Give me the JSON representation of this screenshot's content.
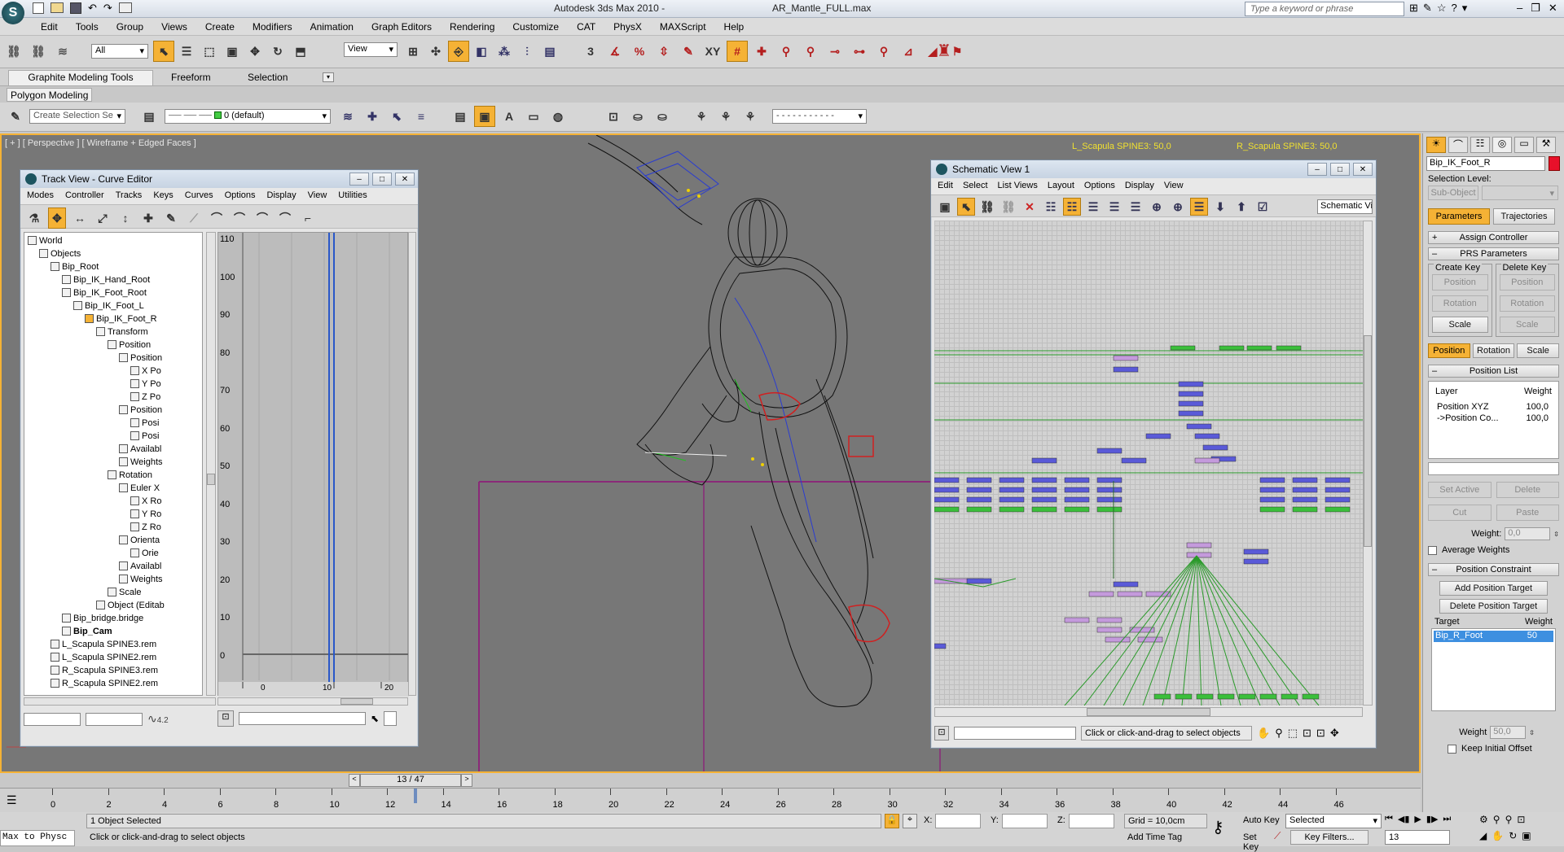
{
  "app": {
    "title": "Autodesk 3ds Max 2010",
    "file": "AR_Mantle_FULL.max",
    "search_placeholder": "Type a keyword or phrase"
  },
  "menu": [
    "Edit",
    "Tools",
    "Group",
    "Views",
    "Create",
    "Modifiers",
    "Animation",
    "Graph Editors",
    "Rendering",
    "Customize",
    "CAT",
    "PhysX",
    "MAXScript",
    "Help"
  ],
  "main_toolbar": {
    "filter": "All",
    "ref_coord": "View",
    "snap_label": "3"
  },
  "ribbon": {
    "tabs": [
      "Graphite Modeling Tools",
      "Freeform",
      "Selection"
    ],
    "sub_tab": "Polygon Modeling",
    "selection_set_placeholder": "Create Selection Se",
    "layer": "0 (default)"
  },
  "viewport": {
    "label": "[ + ] [ Perspective ] [ Wireframe + Edged Faces ]",
    "status_left": "L_Scapula SPINE3: 50,0",
    "status_right": "R_Scapula SPINE3: 50,0"
  },
  "curve_editor": {
    "title": "Track View - Curve Editor",
    "menu": [
      "Modes",
      "Controller",
      "Tracks",
      "Keys",
      "Curves",
      "Options",
      "Display",
      "View",
      "Utilities"
    ],
    "tree": [
      {
        "label": "World",
        "depth": 0
      },
      {
        "label": "Objects",
        "depth": 1
      },
      {
        "label": "Bip_Root",
        "depth": 2
      },
      {
        "label": "Bip_IK_Hand_Root",
        "depth": 3
      },
      {
        "label": "Bip_IK_Foot_Root",
        "depth": 3
      },
      {
        "label": "Bip_IK_Foot_L",
        "depth": 4
      },
      {
        "label": "Bip_IK_Foot_R",
        "depth": 5
      },
      {
        "label": "Transform",
        "depth": 6
      },
      {
        "label": "Position",
        "depth": 7
      },
      {
        "label": "Position",
        "depth": 8
      },
      {
        "label": "X Po",
        "depth": 9
      },
      {
        "label": "Y Po",
        "depth": 9
      },
      {
        "label": "Z Po",
        "depth": 9
      },
      {
        "label": "Position",
        "depth": 8
      },
      {
        "label": "Posi",
        "depth": 9
      },
      {
        "label": "Posi",
        "depth": 9
      },
      {
        "label": "Availabl",
        "depth": 8
      },
      {
        "label": "Weights",
        "depth": 8
      },
      {
        "label": "Rotation",
        "depth": 7
      },
      {
        "label": "Euler X",
        "depth": 8
      },
      {
        "label": "X Ro",
        "depth": 9
      },
      {
        "label": "Y Ro",
        "depth": 9
      },
      {
        "label": "Z Ro",
        "depth": 9
      },
      {
        "label": "Orienta",
        "depth": 8
      },
      {
        "label": "Orie",
        "depth": 9
      },
      {
        "label": "Availabl",
        "depth": 8
      },
      {
        "label": "Weights",
        "depth": 8
      },
      {
        "label": "Scale",
        "depth": 7
      },
      {
        "label": "Object (Editab",
        "depth": 6
      },
      {
        "label": "Bip_bridge.bridge",
        "depth": 3
      },
      {
        "label": "Bip_Cam",
        "depth": 3
      },
      {
        "label": "L_Scapula SPINE3.rem",
        "depth": 2
      },
      {
        "label": "L_Scapula SPINE2.rem",
        "depth": 2
      },
      {
        "label": "R_Scapula SPINE3.rem",
        "depth": 2
      },
      {
        "label": "R_Scapula SPINE2.rem",
        "depth": 2
      }
    ],
    "y_ticks": [
      "110",
      "100",
      "90",
      "80",
      "70",
      "60",
      "50",
      "40",
      "30",
      "20",
      "10",
      "0"
    ],
    "x_ticks": [
      "0",
      "10",
      "20"
    ],
    "bottom_value": "4.2"
  },
  "schematic": {
    "title": "Schematic View 1",
    "menu": [
      "Edit",
      "Select",
      "List Views",
      "Layout",
      "Options",
      "Display",
      "View"
    ],
    "view_name": "Schematic Vie",
    "status": "Click or click-and-drag to select objects"
  },
  "command_panel": {
    "object_name": "Bip_IK_Foot_R",
    "selection_level_label": "Selection Level:",
    "sub_object": "Sub-Object",
    "tabs": [
      "Parameters",
      "Trajectories"
    ],
    "assign_controller": "Assign Controller",
    "prs": "PRS Parameters",
    "create_key": "Create Key",
    "delete_key": "Delete Key",
    "key_buttons": [
      "Position",
      "Rotation",
      "Scale"
    ],
    "prs_tabs": [
      "Position",
      "Rotation",
      "Scale"
    ],
    "position_list": "Position List",
    "layer_header": "Layer",
    "weight_header": "Weight",
    "layers": [
      {
        "name": "Position XYZ",
        "weight": "100,0"
      },
      {
        "name": "->Position Co...",
        "weight": "100,0"
      }
    ],
    "set_active": "Set Active",
    "delete": "Delete",
    "cut": "Cut",
    "paste": "Paste",
    "weight_label": "Weight:",
    "weight_value": "0,0",
    "average_weights": "Average Weights",
    "position_constraint": "Position Constraint",
    "add_target": "Add Position Target",
    "delete_target": "Delete Position Target",
    "target_header": "Target",
    "target_weight_header": "Weight",
    "targets": [
      {
        "name": "Bip_R_Foot",
        "weight": "50"
      }
    ],
    "weight2_label": "Weight",
    "weight2_value": "50,0",
    "keep_offset": "Keep Initial Offset"
  },
  "timeline": {
    "frame": "13 / 47",
    "ticks": [
      "0",
      "2",
      "4",
      "6",
      "8",
      "10",
      "12",
      "14",
      "16",
      "18",
      "20",
      "22",
      "24",
      "26",
      "28",
      "30",
      "32",
      "34",
      "36",
      "38",
      "40",
      "42",
      "44",
      "46"
    ],
    "current_frame": "13"
  },
  "status": {
    "listener": "Max to Physc",
    "selected": "1 Object Selected",
    "prompt": "Click or click-and-drag to select objects",
    "x_label": "X:",
    "y_label": "Y:",
    "z_label": "Z:",
    "grid": "Grid = 10,0cm",
    "add_time_tag": "Add Time Tag",
    "auto_key": "Auto Key",
    "set_key": "Set Key",
    "key_mode": "Selected",
    "key_filters": "Key Filters..."
  },
  "colors": {
    "accent": "#f5b235",
    "viewport_bg": "#777777",
    "selected_blue": "#3d8fe0"
  }
}
